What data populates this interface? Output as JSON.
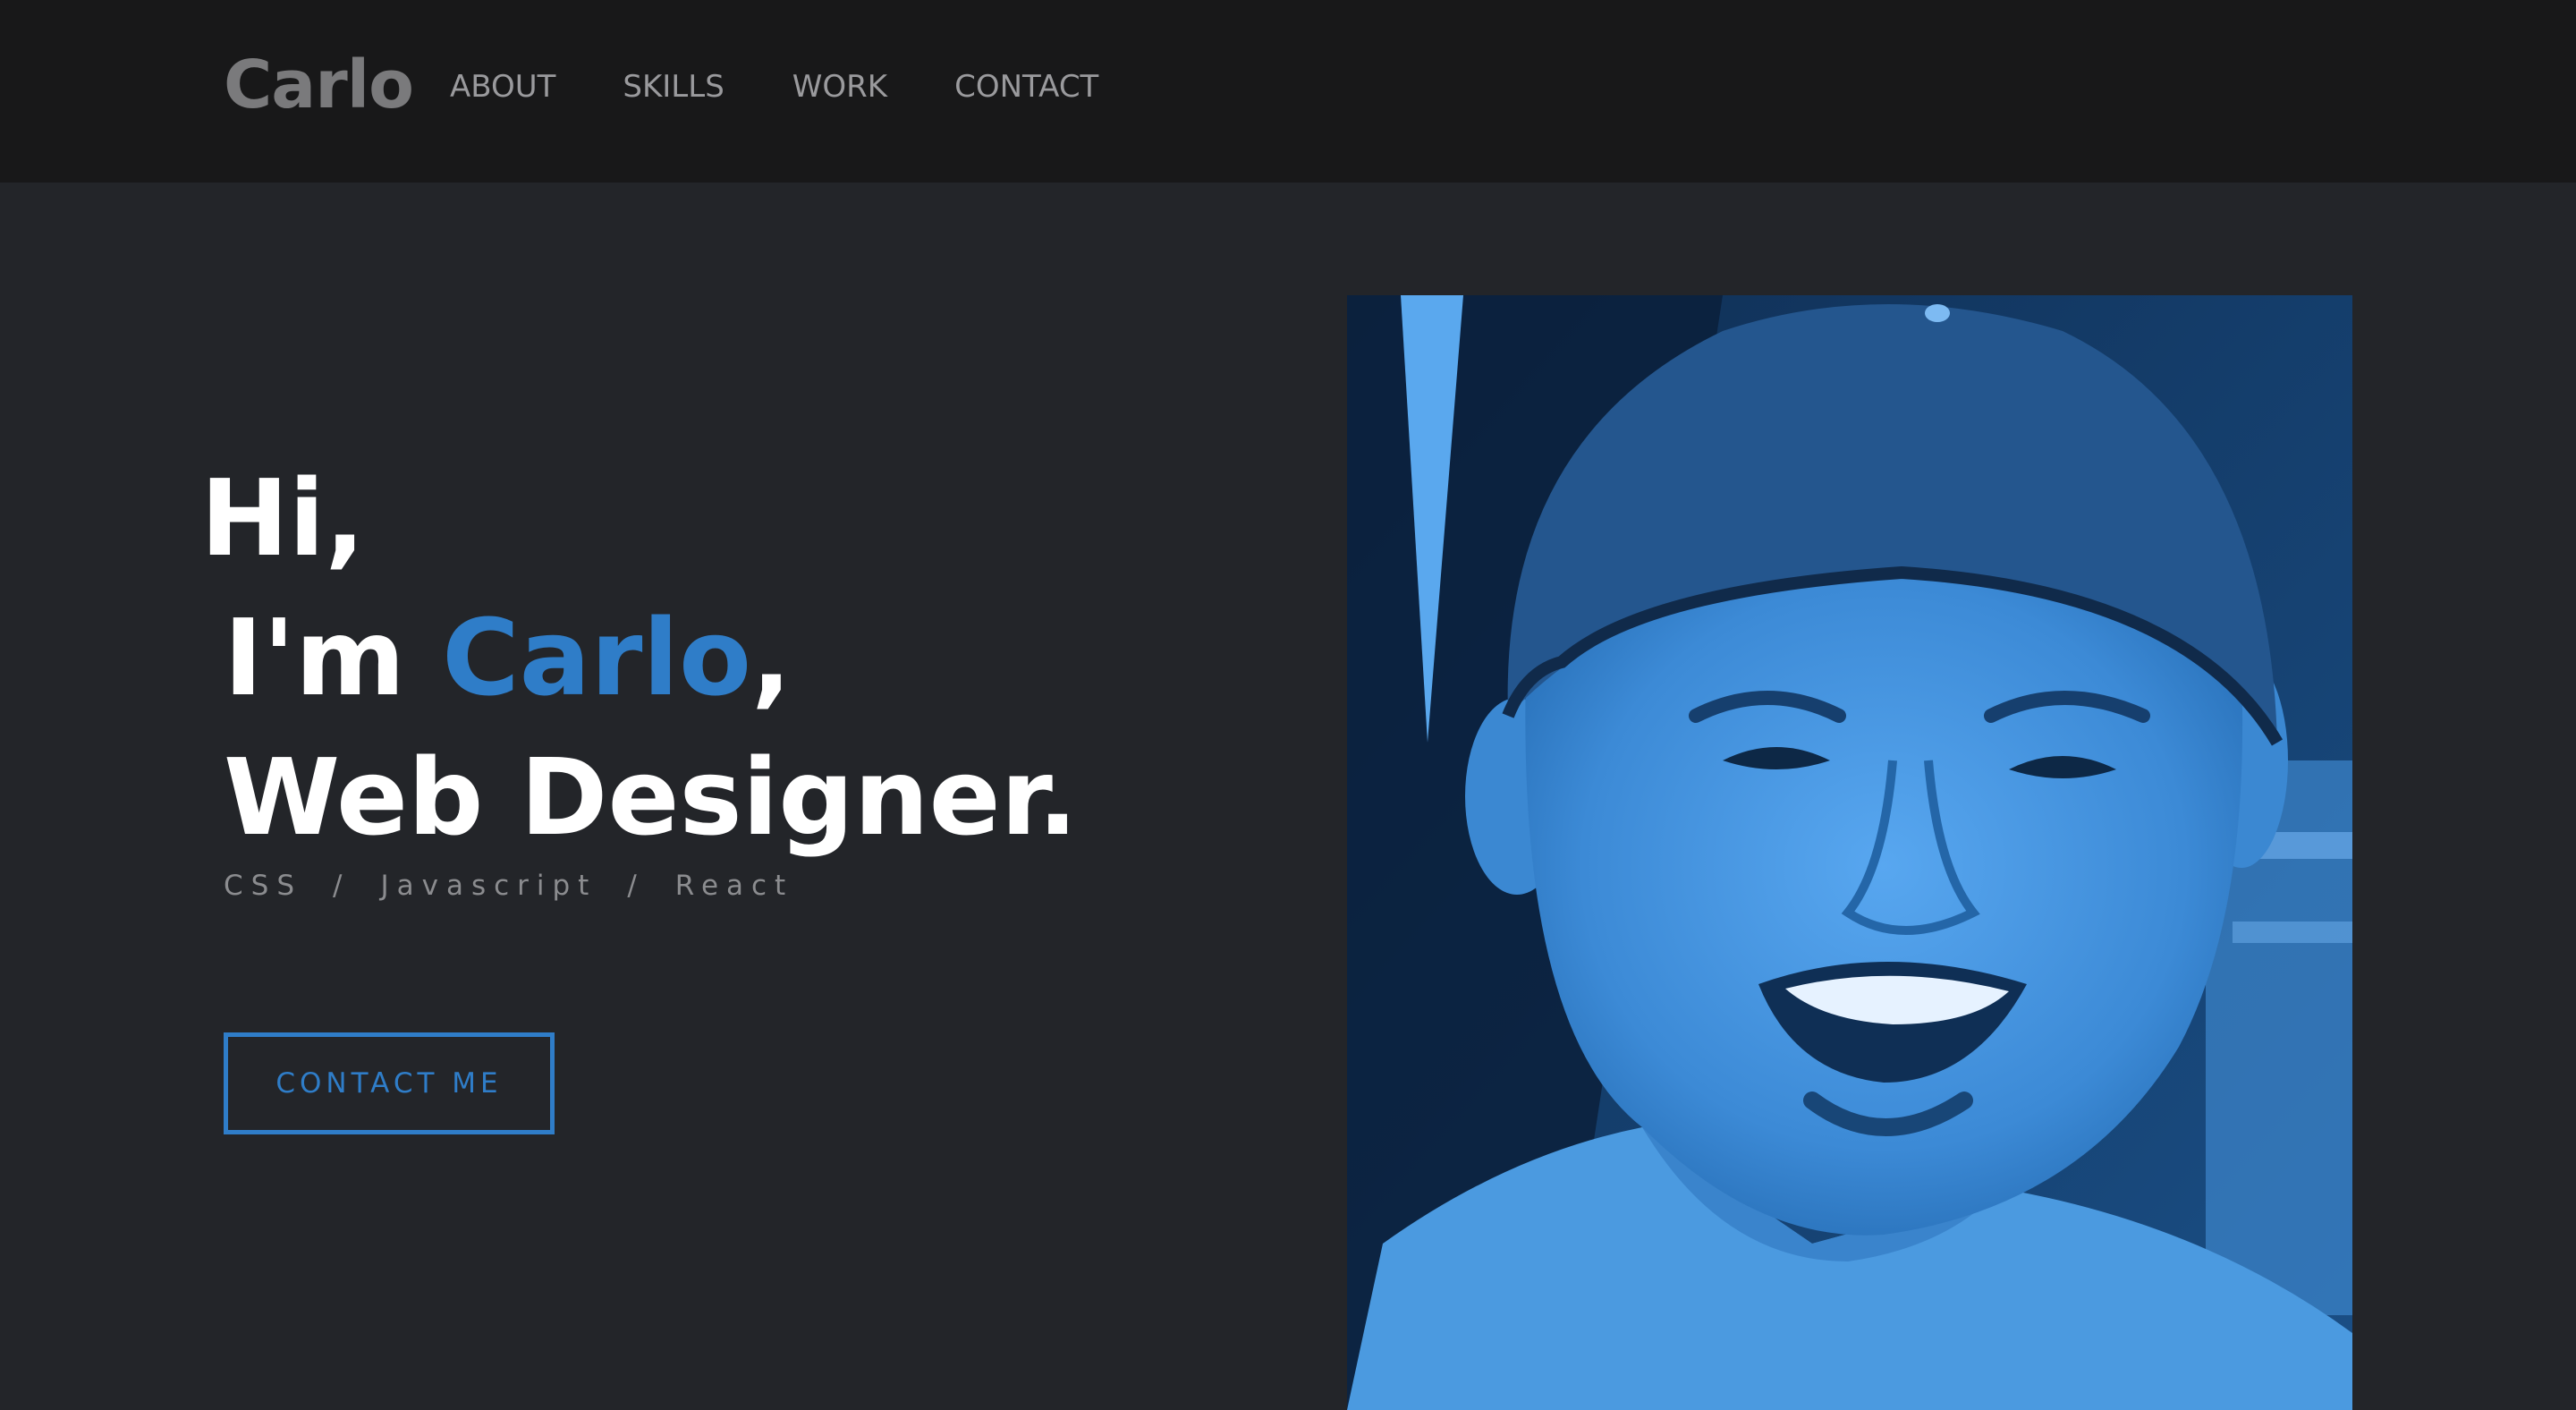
{
  "nav": {
    "logo": "Carlo",
    "links": [
      {
        "label": "ABOUT"
      },
      {
        "label": "SKILLS"
      },
      {
        "label": "WORK"
      },
      {
        "label": "CONTACT"
      }
    ]
  },
  "hero": {
    "greeting": "Hi,",
    "intro_prefix": "I'm ",
    "name": "Carlo",
    "intro_suffix": ",",
    "role": "Web Designer.",
    "skills": [
      "CSS",
      "Javascript",
      "React"
    ],
    "separator": "/",
    "cta_label": "CONTACT ME"
  },
  "colors": {
    "accent": "#2f7dc8",
    "background": "#232529",
    "navbar": "#181819"
  }
}
